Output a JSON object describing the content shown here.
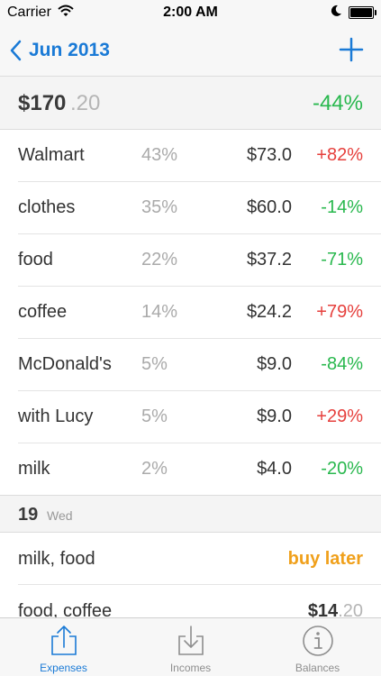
{
  "status_bar": {
    "carrier": "Carrier",
    "time": "2:00 AM"
  },
  "nav": {
    "back_label": "Jun 2013"
  },
  "summary": {
    "amount": "$170",
    "cents": ".20",
    "change": "-44%"
  },
  "categories": [
    {
      "name": "Walmart",
      "percent": "43%",
      "amount": "$73.0",
      "change": "+82%",
      "trend": "pos"
    },
    {
      "name": "clothes",
      "percent": "35%",
      "amount": "$60.0",
      "change": "-14%",
      "trend": "neg"
    },
    {
      "name": "food",
      "percent": "22%",
      "amount": "$37.2",
      "change": "-71%",
      "trend": "neg"
    },
    {
      "name": "coffee",
      "percent": "14%",
      "amount": "$24.2",
      "change": "+79%",
      "trend": "pos"
    },
    {
      "name": "McDonald's",
      "percent": "5%",
      "amount": "$9.0",
      "change": "-84%",
      "trend": "neg"
    },
    {
      "name": "with Lucy",
      "percent": "5%",
      "amount": "$9.0",
      "change": "+29%",
      "trend": "pos"
    },
    {
      "name": "milk",
      "percent": "2%",
      "amount": "$4.0",
      "change": "-20%",
      "trend": "neg"
    }
  ],
  "day_header": {
    "day": "19",
    "weekday": "Wed"
  },
  "entries": [
    {
      "name": "milk, food",
      "status": "buy later"
    },
    {
      "name": "food, coffee",
      "amount": "$14",
      "cents": ".20"
    }
  ],
  "tabs": [
    {
      "label": "Expenses",
      "icon": "share-box-icon"
    },
    {
      "label": "Incomes",
      "icon": "download-box-icon"
    },
    {
      "label": "Balances",
      "icon": "info-circle-icon"
    }
  ],
  "colors": {
    "accent": "#1a7ad6",
    "positive_change": "#e6403d",
    "negative_change": "#29b84e",
    "pending": "#f0a01b"
  }
}
